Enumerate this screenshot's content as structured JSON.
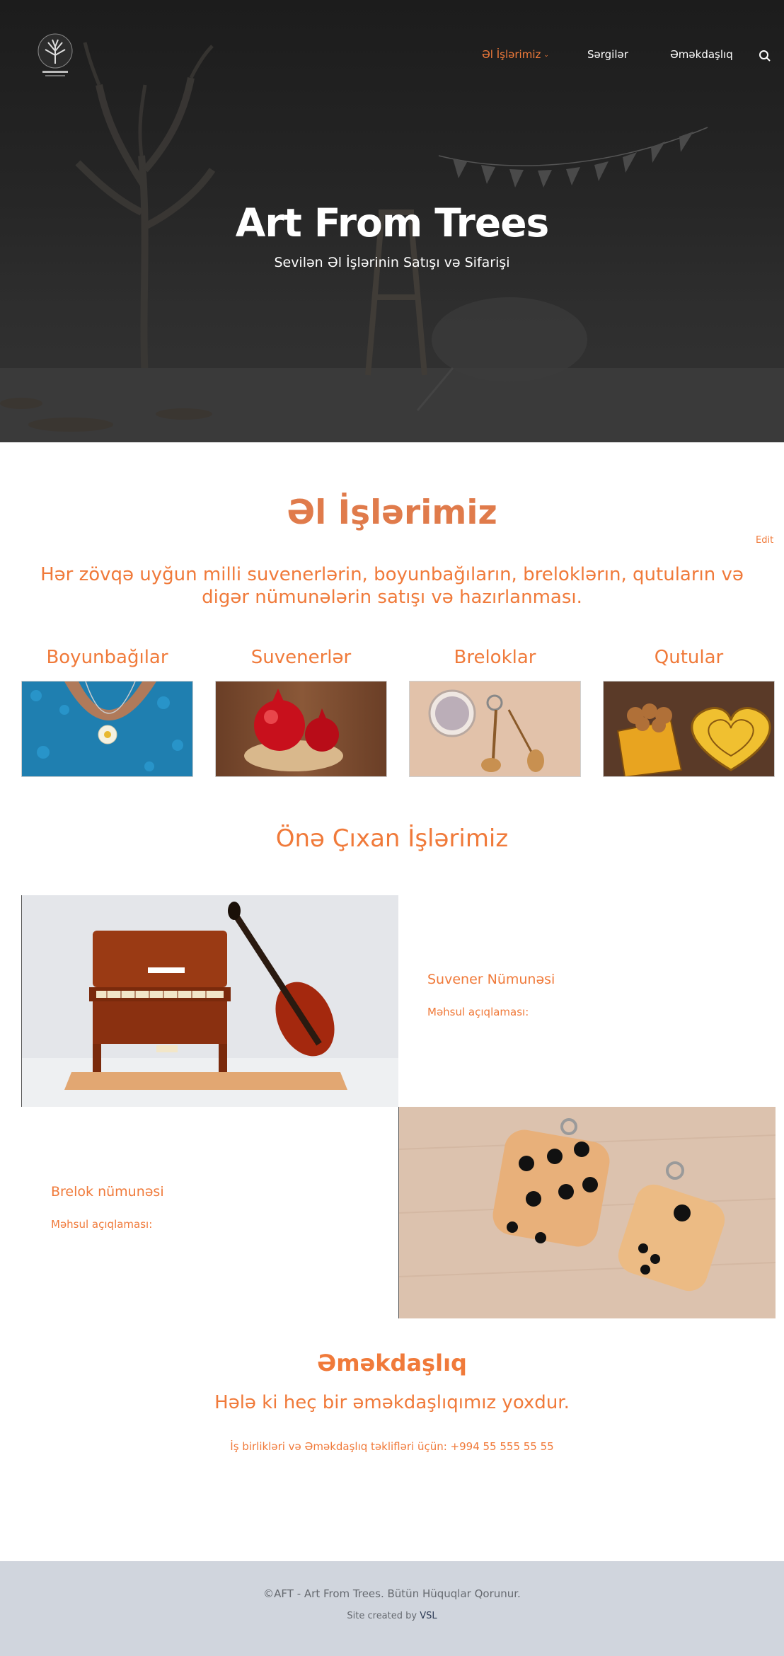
{
  "nav": {
    "items": [
      {
        "label": "Əl İşlərimiz",
        "active": true,
        "has_dropdown": true
      },
      {
        "label": "Sərgilər",
        "active": false
      },
      {
        "label": "Əməkdaşlıq",
        "active": false
      }
    ],
    "search_icon": "search-icon",
    "chevron": "⌄"
  },
  "logo": {
    "icon": "tree-logo-icon"
  },
  "hero": {
    "title": "Art From Trees",
    "subtitle": "Sevilən Əl İşlərinin Satışı və Sifarişi"
  },
  "works": {
    "title": "Əl İşlərimiz",
    "edit_label": "Edit",
    "intro": "Hər zövqə uyğun milli suvenerlərin, boyunbağıların, breloklərın, qutuların və digər nümunələrin satışı və hazırlanması.",
    "categories": [
      {
        "label": "Boyunbağılar",
        "image": "necklace-photo"
      },
      {
        "label": "Suvenerlər",
        "image": "pomegranate-souvenir-photo"
      },
      {
        "label": "Breloklar",
        "image": "keychain-instruments-photo"
      },
      {
        "label": "Qutular",
        "image": "heart-box-photo"
      }
    ]
  },
  "featured": {
    "title": "Önə Çıxan İşlərimiz",
    "items": [
      {
        "name": "Suvener Nümunəsi",
        "description": "Məhsul açıqlaması:",
        "image": "piano-violin-souvenir-photo"
      },
      {
        "name": "Brelok nümunəsi",
        "description": "Məhsul açıqlaması:",
        "image": "wooden-dice-keychain-photo"
      }
    ]
  },
  "cooperation": {
    "title": "Əməkdaşlıq",
    "message": "Hələ ki heç bir əməkdaşlıqımız yoxdur.",
    "contact": "İş birlikləri və Əməkdaşlıq təklifləri üçün: +994 55 555 55 55"
  },
  "footer": {
    "copyright": "©AFT - Art From Trees. Bütün Hüquqlar Qorunur.",
    "credit_prefix": "Site created by",
    "credit_link": "VSL"
  },
  "colors": {
    "accent": "#f07a3a",
    "footer_bg": "#d0d5dd",
    "hero_bg": "#262626"
  }
}
